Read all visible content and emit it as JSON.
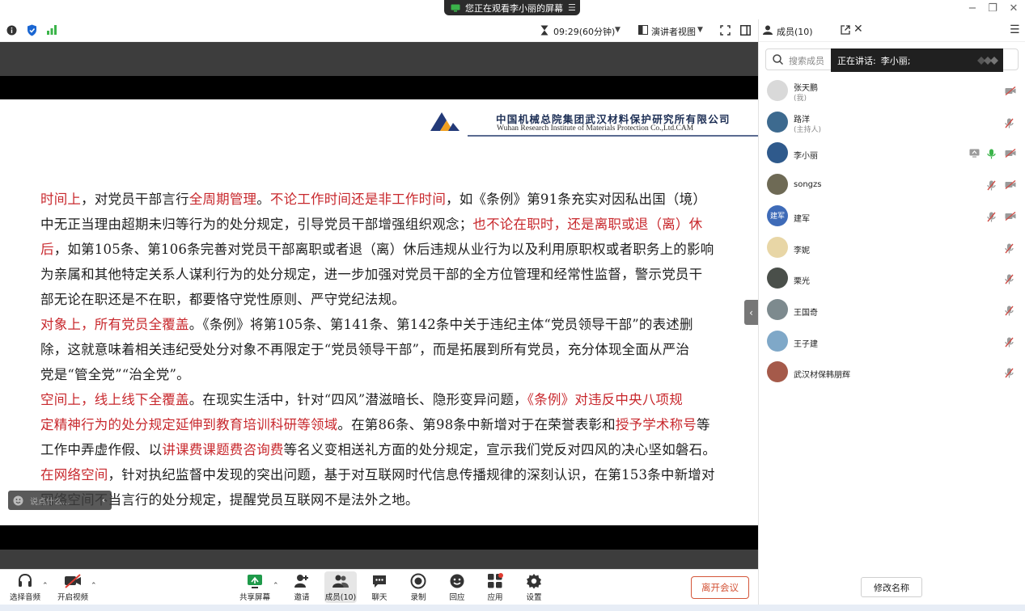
{
  "window": {
    "sharing_banner": "您正在观看李小丽的屏幕"
  },
  "infobar": {
    "timer": "09:29(60分钟)",
    "view_mode": "演讲者视图"
  },
  "slide": {
    "org_name_cn": "中国机械总院集团武汉材料保护研究所有限公司",
    "org_name_en": "Wuhan Research Institute of Materials Protection Co.,Ltd.CAM",
    "lines": [
      [
        {
          "t": "时间上",
          "c": "red"
        },
        {
          "t": "，对党员干部言行"
        },
        {
          "t": "全周期管理",
          "c": "red"
        },
        {
          "t": "。"
        },
        {
          "t": "不论工作时间还是非工作时间",
          "c": "red"
        },
        {
          "t": "，如《条例》第91条充实对因私出国（境）"
        }
      ],
      [
        {
          "t": "中无正当理由超期未归等行为的处分规定，引导党员干部增强组织观念；"
        },
        {
          "t": "也不论在职时，还是离职或退（离）休",
          "c": "red"
        }
      ],
      [
        {
          "t": "后",
          "c": "red"
        },
        {
          "t": "，如第105条、第106条完善对党员干部离职或者退（离）休后违规从业行为以及利用原职权或者职务上的影响"
        }
      ],
      [
        {
          "t": "为亲属和其他特定关系人谋利行为的处分规定，进一步加强对党员干部的全方位管理和经常性监督，警示党员干"
        }
      ],
      [
        {
          "t": "部无论在职还是不在职，都要恪守党性原则、严守党纪法规。"
        }
      ],
      [
        {
          "t": "对象上，所有党员全覆盖",
          "c": "red"
        },
        {
          "t": "。《条例》将第105条、第141条、第142条中关于违纪主体“党员领导干部”的表述删"
        }
      ],
      [
        {
          "t": "除，这就意味着相关违纪受处分对象不再限定于“党员领导干部”，而是拓展到所有党员，充分体现全面从严治"
        }
      ],
      [
        {
          "t": "党是“管全党”“治全党”。"
        }
      ],
      [
        {
          "t": "空间上，线上线下全覆盖",
          "c": "red"
        },
        {
          "t": "。在现实生活中，针对“四风”潜滋暗长、隐形变异问题，"
        },
        {
          "t": "《条例》对违反中央八项规",
          "c": "red"
        }
      ],
      [
        {
          "t": "定精神行为的处分规定延伸到教育培训科研等领域",
          "c": "red"
        },
        {
          "t": "。在第86条、第98条中新增对于在荣誉表彰和"
        },
        {
          "t": "授予学术称号",
          "c": "red"
        },
        {
          "t": "等"
        }
      ],
      [
        {
          "t": "工作中弄虚作假、以"
        },
        {
          "t": "讲课费课题费咨询费",
          "c": "red"
        },
        {
          "t": "等名义变相送礼方面的处分规定，宣示我们党反对四风的决心坚如磐石。"
        }
      ],
      [
        {
          "t": "在网络空间",
          "c": "red"
        },
        {
          "t": "，针对执纪监督中发现的突出问题，基于对互联网时代信息传播规律的深刻认识，在第153条中新增对"
        }
      ],
      [
        {
          "t": "网络空间不当言行的处分规定，提醒党员互联网不是法外之地。"
        }
      ]
    ]
  },
  "chat_overlay": {
    "placeholder": "说点什么..."
  },
  "panel": {
    "tab_label": "成员(10)",
    "search_placeholder": "搜索成员",
    "speaking_label": "正在讲话:",
    "speaking_name": "李小丽;",
    "rename_button": "修改名称",
    "members": [
      {
        "name": "张天鹏",
        "sub": "(我)",
        "avatar_color": "#d9d9d9",
        "avatar_text": "",
        "icons": [
          "video-off-icon"
        ]
      },
      {
        "name": "路洋",
        "sub": "(主持人)",
        "avatar_color": "#3d6a8f",
        "avatar_text": "",
        "icons": [
          "mic-off-icon"
        ]
      },
      {
        "name": "李小丽",
        "sub": "",
        "avatar_color": "#2f5a8c",
        "avatar_text": "",
        "icons": [
          "screen-share-icon",
          "mic-on-icon",
          "video-off-icon"
        ]
      },
      {
        "name": "songzs",
        "sub": "",
        "avatar_color": "#6e6a55",
        "avatar_text": "",
        "icons": [
          "mic-off-icon",
          "video-off-icon"
        ]
      },
      {
        "name": "建军",
        "sub": "",
        "avatar_color": "#3e6bb8",
        "avatar_text": "建军",
        "icons": [
          "mic-off-icon",
          "video-off-icon"
        ]
      },
      {
        "name": "李妮",
        "sub": "",
        "avatar_color": "#e8d6a6",
        "avatar_text": "",
        "icons": [
          "mic-off-icon"
        ]
      },
      {
        "name": "栗光",
        "sub": "",
        "avatar_color": "#4a4f4a",
        "avatar_text": "",
        "icons": [
          "mic-off-icon"
        ]
      },
      {
        "name": "王国奇",
        "sub": "",
        "avatar_color": "#7d8a8e",
        "avatar_text": "",
        "icons": [
          "mic-off-icon"
        ]
      },
      {
        "name": "王子建",
        "sub": "",
        "avatar_color": "#7fa8c8",
        "avatar_text": "",
        "icons": [
          "mic-off-icon"
        ]
      },
      {
        "name": "武汉材保韩朋辉",
        "sub": "",
        "avatar_color": "#a55a4a",
        "avatar_text": "",
        "icons": [
          "mic-off-icon"
        ]
      }
    ]
  },
  "toolbar": {
    "audio": "选择音频",
    "video": "开启视频",
    "share": "共享屏幕",
    "invite": "邀请",
    "members": "成员(10)",
    "chat": "聊天",
    "record": "录制",
    "reactions": "回应",
    "apps": "应用",
    "settings": "设置",
    "leave": "离开会议"
  },
  "colors": {
    "accent_red": "#c8282d",
    "leave_red": "#d4563a",
    "mic_green": "#3bb44a",
    "mute_red": "#d0504a"
  }
}
